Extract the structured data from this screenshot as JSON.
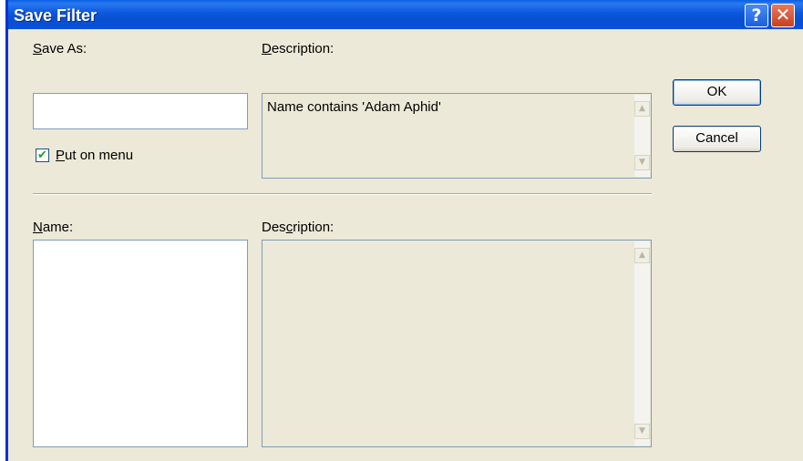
{
  "window": {
    "title": "Save Filter",
    "help_glyph": "?",
    "close_glyph": "✕",
    "colors": {
      "titlebar": "#0A52D6",
      "face": "#ECE9D8",
      "checkmark": "#21A121"
    }
  },
  "save_as": {
    "label_hotkey": "S",
    "label_rest": "ave As:",
    "value": ""
  },
  "description_top": {
    "label_hotkey": "D",
    "label_rest": "escription:",
    "text": "Name  contains 'Adam Aphid'"
  },
  "put_on_menu": {
    "checked": true,
    "check_glyph": "✔",
    "label_hotkey": "P",
    "label_rest": "ut on menu"
  },
  "name_list": {
    "label_hotkey": "N",
    "label_rest": "ame:",
    "items": []
  },
  "description_bottom": {
    "label_pre": "Des",
    "label_hotkey": "c",
    "label_rest": "ription:",
    "text": ""
  },
  "scroll": {
    "up_glyph": "▲",
    "down_glyph": "▼"
  },
  "buttons": {
    "ok": "OK",
    "cancel": "Cancel"
  }
}
